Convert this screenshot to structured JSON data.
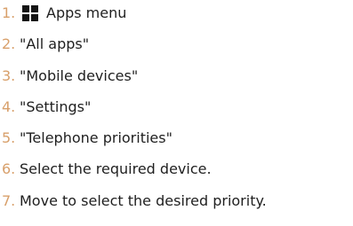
{
  "steps": [
    {
      "number": "1.",
      "text": "Apps menu",
      "icon": "apps-grid-icon"
    },
    {
      "number": "2.",
      "text": "\"All apps\""
    },
    {
      "number": "3.",
      "text": "\"Mobile devices\""
    },
    {
      "number": "4.",
      "text": "\"Settings\""
    },
    {
      "number": "5.",
      "text": "\"Telephone priorities\""
    },
    {
      "number": "6.",
      "text": "Select the required device."
    },
    {
      "number": "7.",
      "text": "Move to select the desired priority."
    }
  ],
  "colors": {
    "number": "#d8a06b",
    "text": "#1f1f1f",
    "icon": "#141414"
  }
}
